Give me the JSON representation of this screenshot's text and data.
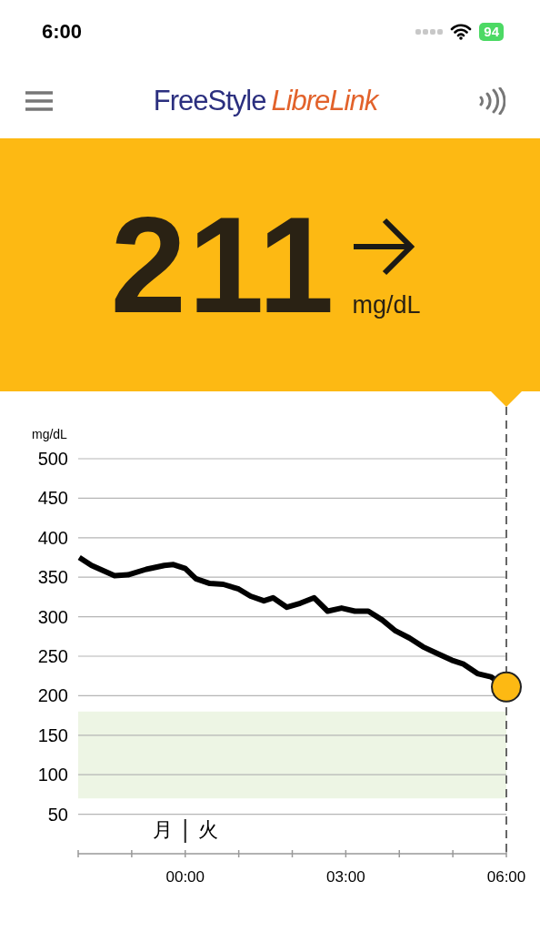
{
  "status_bar": {
    "time": "6:00",
    "battery": "94"
  },
  "header": {
    "logo_part_1": "FreeStyle",
    "logo_part_2": "LibreLink"
  },
  "reading": {
    "value": "211",
    "unit": "mg/dL"
  },
  "chart": {
    "day_boundary": {
      "before": "月",
      "after": "火"
    },
    "chart_data": {
      "type": "line",
      "ylabel": "mg/dL",
      "xlim": [
        -2,
        6
      ],
      "ylim": [
        0,
        500
      ],
      "xticks": [
        {
          "value": 0,
          "label": "00:00"
        },
        {
          "value": 3,
          "label": "03:00"
        },
        {
          "value": 6,
          "label": "06:00"
        }
      ],
      "yticks": [
        50,
        100,
        150,
        200,
        250,
        300,
        350,
        400,
        450,
        500
      ],
      "x": [
        -1.98,
        -1.75,
        -1.32,
        -1.07,
        -0.73,
        -0.39,
        -0.22,
        0,
        0.2,
        0.46,
        0.71,
        1,
        1.22,
        1.47,
        1.64,
        1.9,
        2.15,
        2.41,
        2.66,
        2.92,
        3.17,
        3.42,
        3.68,
        3.93,
        4.19,
        4.44,
        4.69,
        4.98,
        5.2,
        5.46,
        5.71,
        6
      ],
      "grid": true,
      "series": [
        {
          "color": "#000000",
          "values": [
            375,
            365,
            352,
            353,
            360,
            365,
            366,
            361,
            348,
            342,
            341,
            335,
            326,
            320,
            324,
            312,
            317,
            324,
            307,
            311,
            307,
            307,
            296,
            282,
            273,
            262,
            254,
            245,
            240,
            228,
            224,
            211
          ]
        }
      ],
      "bands": [
        {
          "axis": "y",
          "from": 70,
          "to": 180,
          "color": "#edf5e4"
        }
      ]
    }
  }
}
